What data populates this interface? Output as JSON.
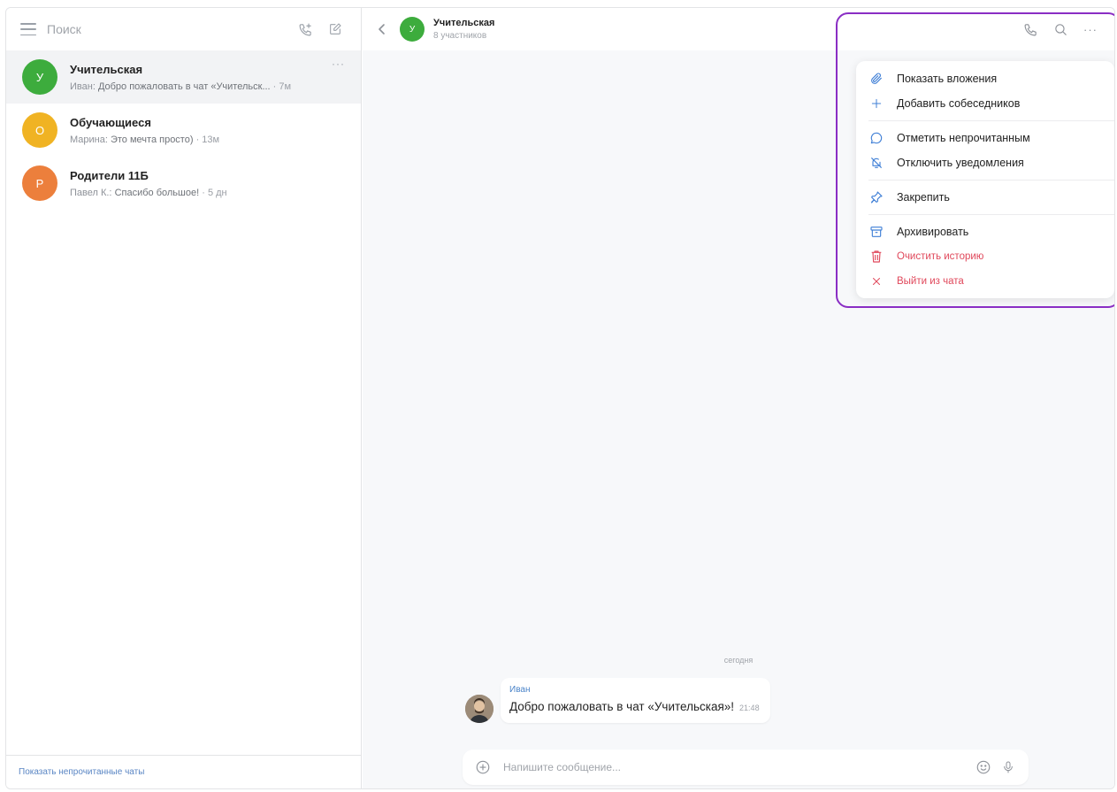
{
  "sidebar": {
    "search_placeholder": "Поиск",
    "chats": [
      {
        "initial": "У",
        "title": "Учительская",
        "sender": "Иван:",
        "text": "Добро пожаловать в чат «Учительск...",
        "time": "· 7м",
        "color": "#3dac3d",
        "active": true,
        "more": "···"
      },
      {
        "initial": "О",
        "title": "Обучающиеся",
        "sender": "Марина:",
        "text": "Это мечта просто)",
        "time": "· 13м",
        "color": "#f0b323",
        "active": false
      },
      {
        "initial": "Р",
        "title": "Родители 11Б",
        "sender": "Павел К.:",
        "text": "Спасибо большое!",
        "time": "· 5 дн",
        "color": "#ec7f3c",
        "active": false
      }
    ],
    "footer_link": "Показать непрочитанные чаты"
  },
  "header": {
    "avatar_initial": "У",
    "title": "Учительская",
    "subtitle": "8 участников",
    "more_label": "···"
  },
  "menu": {
    "items": [
      {
        "label": "Показать вложения",
        "icon": "paperclip-icon",
        "danger": false
      },
      {
        "label": "Добавить собеседников",
        "icon": "plus-icon",
        "danger": false,
        "sep_after": true
      },
      {
        "label": "Отметить непрочитанным",
        "icon": "chat-bubble-icon",
        "danger": false
      },
      {
        "label": "Отключить уведомления",
        "icon": "bell-off-icon",
        "danger": false,
        "sep_after": true
      },
      {
        "label": "Закрепить",
        "icon": "pin-icon",
        "danger": false,
        "sep_after": true
      },
      {
        "label": "Архивировать",
        "icon": "archive-icon",
        "danger": false
      },
      {
        "label": "Очистить историю",
        "icon": "trash-icon",
        "danger": true
      },
      {
        "label": "Выйти из чата",
        "icon": "close-icon",
        "danger": true
      }
    ],
    "highlight_color": "#8a2ec4"
  },
  "messages": {
    "date_label": "сегодня",
    "items": [
      {
        "author": "Иван",
        "text": "Добро пожаловать в чат «Учительская»!",
        "time": "21:48"
      }
    ]
  },
  "composer": {
    "placeholder": "Напишите сообщение..."
  }
}
